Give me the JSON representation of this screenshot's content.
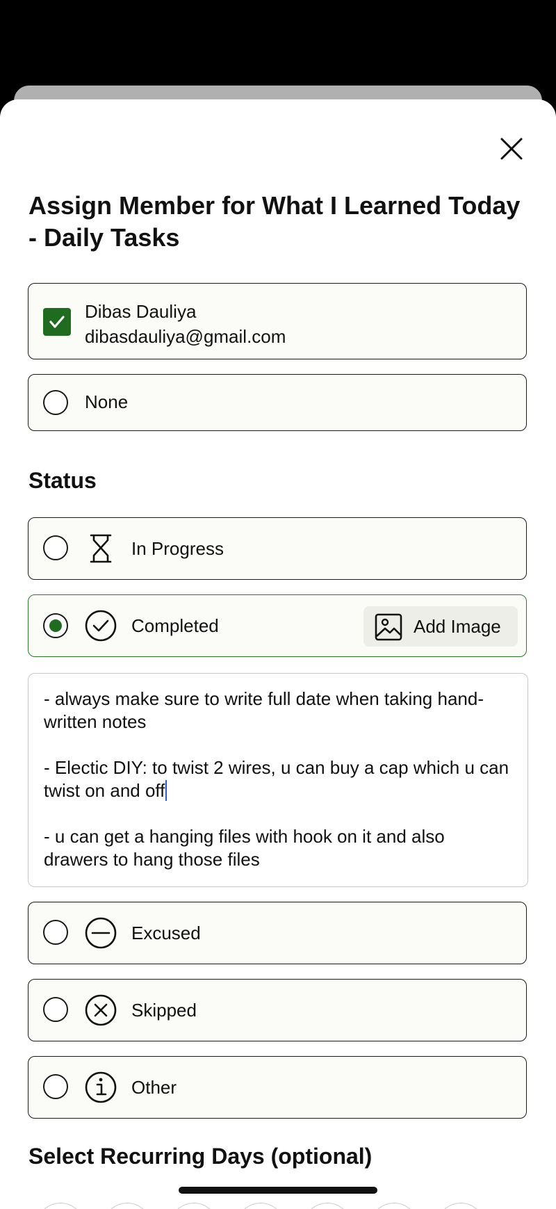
{
  "modal": {
    "title": "Assign Member for What I Learned Today - Daily Tasks"
  },
  "member": {
    "name": "Dibas Dauliya",
    "email": "dibasdauliya@gmail.com",
    "checked": true
  },
  "none_option": {
    "label": "None"
  },
  "status": {
    "title": "Status",
    "options": [
      {
        "label": "In Progress",
        "icon": "hourglass-icon",
        "selected": false
      },
      {
        "label": "Completed",
        "icon": "check-circle-icon",
        "selected": true
      },
      {
        "label": "Excused",
        "icon": "minus-circle-icon",
        "selected": false
      },
      {
        "label": "Skipped",
        "icon": "x-circle-icon",
        "selected": false
      },
      {
        "label": "Other",
        "icon": "info-circle-icon",
        "selected": false
      }
    ],
    "add_image_label": "Add Image",
    "add_image_icon": "image-icon"
  },
  "notes": {
    "paragraphs": [
      "- always make sure to write full date when taking hand-written notes",
      "- Electic DIY: to twist 2 wires, u can buy a cap which u can twist on and off",
      "- u can get a hanging files with hook on it and also drawers to hang those files"
    ]
  },
  "recurring": {
    "title": "Select Recurring Days (optional)"
  },
  "colors": {
    "accent": "#1f6b1f",
    "card_background": "#fbfbf7",
    "caret": "#2a5bd7"
  }
}
